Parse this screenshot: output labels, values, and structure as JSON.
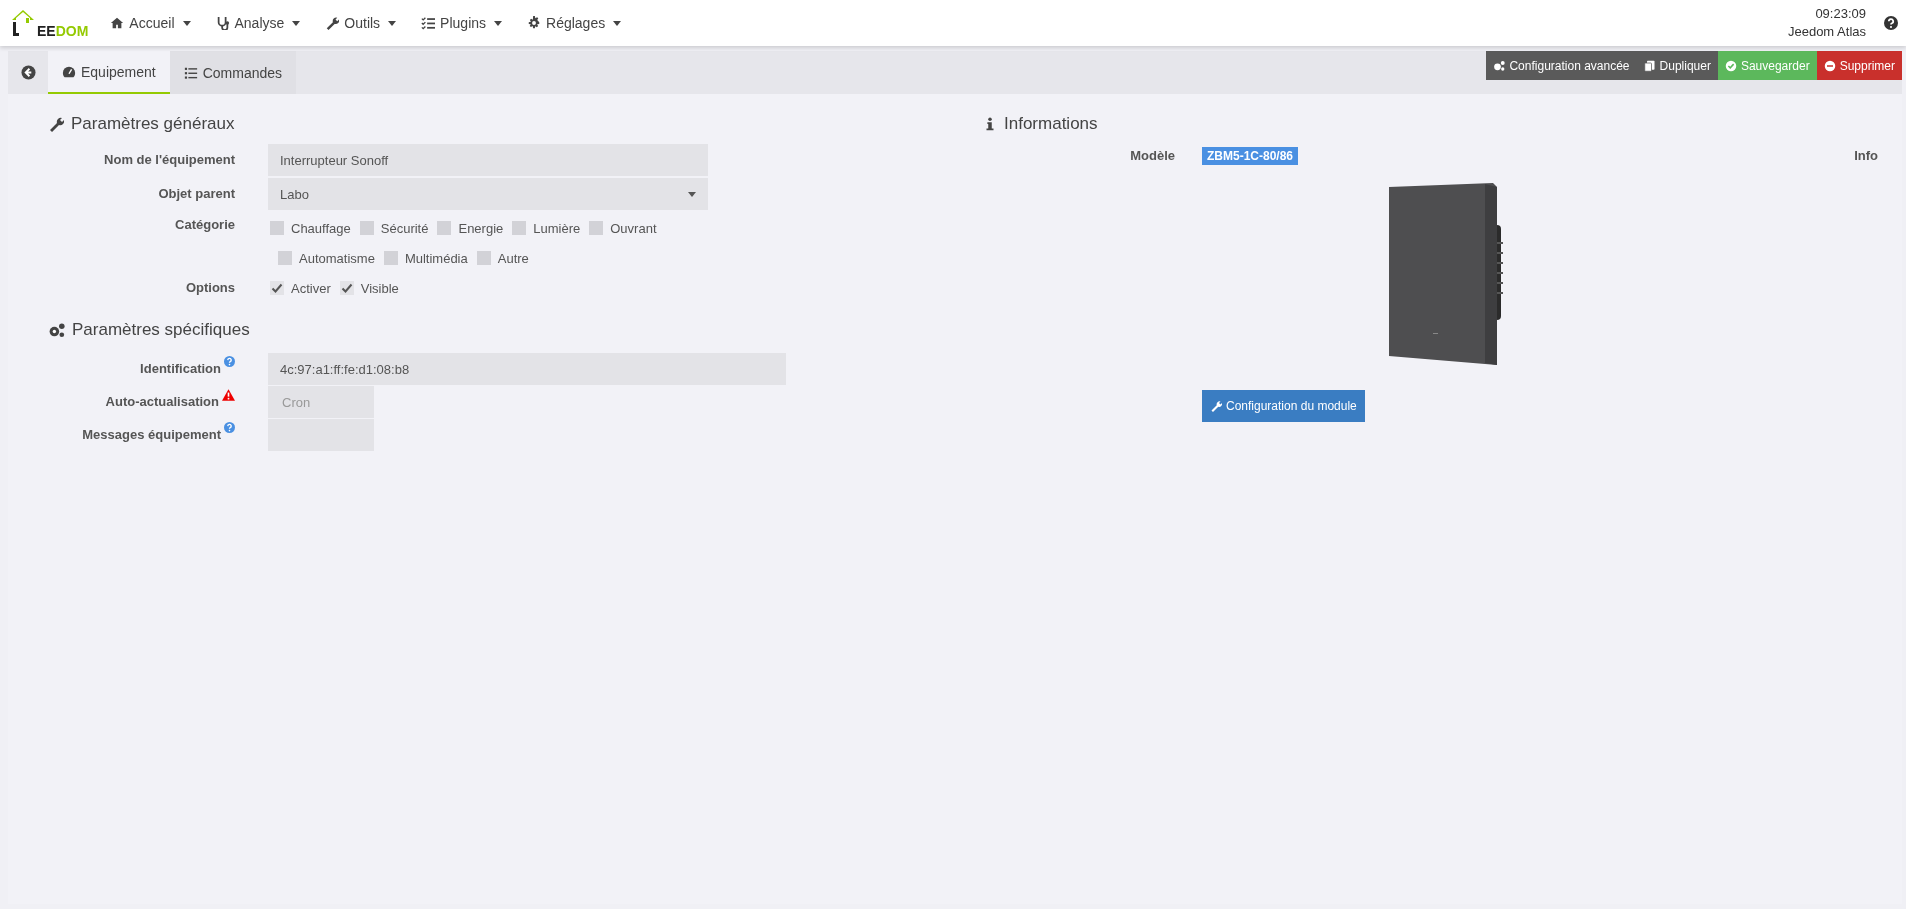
{
  "navbar": {
    "logo": {
      "dark": "EE",
      "accent": "DOM"
    },
    "menus": [
      {
        "label": "Accueil"
      },
      {
        "label": "Analyse"
      },
      {
        "label": "Outils"
      },
      {
        "label": "Plugins"
      },
      {
        "label": "Réglages"
      }
    ],
    "clock": "09:23:09",
    "user": "Jeedom Atlas"
  },
  "tabs": [
    {
      "label": "Equipement",
      "selected": true
    },
    {
      "label": "Commandes",
      "selected": false
    }
  ],
  "actions": [
    {
      "label": "Configuration avancée",
      "kind": "neutral"
    },
    {
      "label": "Dupliquer",
      "kind": "neutral"
    },
    {
      "label": "Sauvegarder",
      "kind": "success"
    },
    {
      "label": "Supprimer",
      "kind": "danger"
    }
  ],
  "general": {
    "title": "Paramètres généraux",
    "name": {
      "label": "Nom de l'équipement",
      "value": "Interrupteur Sonoff"
    },
    "parent": {
      "label": "Objet parent",
      "value": "Labo"
    },
    "category": {
      "label": "Catégorie",
      "options": [
        {
          "label": "Chauffage",
          "checked": false
        },
        {
          "label": "Sécurité",
          "checked": false
        },
        {
          "label": "Energie",
          "checked": false
        },
        {
          "label": "Lumière",
          "checked": false
        },
        {
          "label": "Ouvrant",
          "checked": false
        },
        {
          "label": "Automatisme",
          "checked": false
        },
        {
          "label": "Multimédia",
          "checked": false
        },
        {
          "label": "Autre",
          "checked": false
        }
      ]
    },
    "options": {
      "label": "Options",
      "options": [
        {
          "label": "Activer",
          "checked": true
        },
        {
          "label": "Visible",
          "checked": true
        }
      ]
    }
  },
  "specific": {
    "title": "Paramètres spécifiques",
    "fields": [
      {
        "label": "Identification",
        "kind": "help",
        "value": "4c:97:a1:ff:fe:d1:08:b8"
      },
      {
        "label": "Auto-actualisation",
        "kind": "warning",
        "placeholder": "Cron"
      },
      {
        "label": "Messages équipement",
        "kind": "help"
      }
    ]
  },
  "informations": {
    "title": "Informations",
    "model_label": "Modèle",
    "model": "ZBM5-1C-80/86",
    "info_label": "Info",
    "module_button": "Configuration du module"
  }
}
